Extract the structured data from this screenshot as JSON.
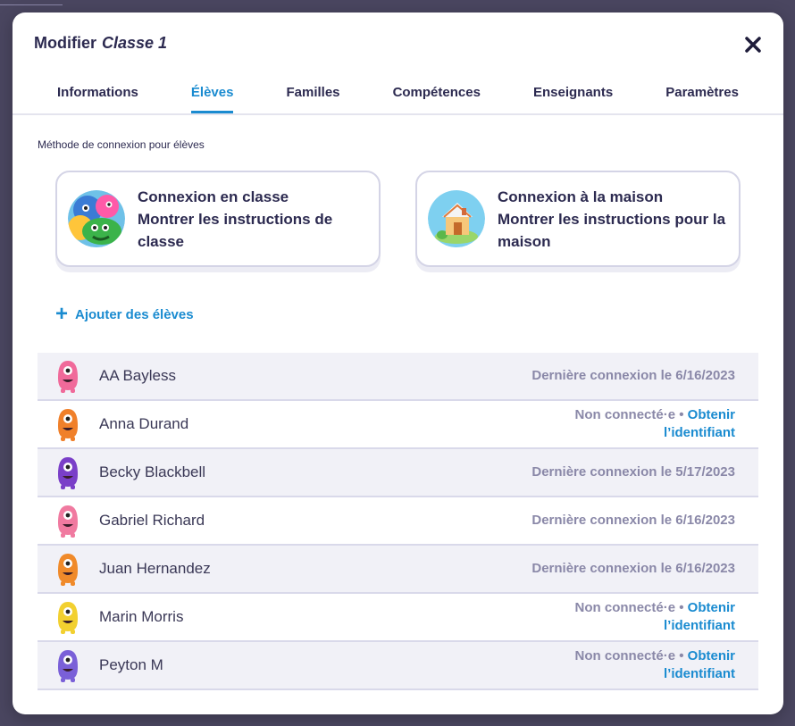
{
  "modal": {
    "title_prefix": "Modifier",
    "class_name": "Classe 1"
  },
  "tabs": [
    {
      "label": "Informations"
    },
    {
      "label": "Élèves"
    },
    {
      "label": "Familles"
    },
    {
      "label": "Compétences"
    },
    {
      "label": "Enseignants"
    },
    {
      "label": "Paramètres"
    }
  ],
  "login": {
    "section_label": "Méthode de connexion pour élèves",
    "class_card": {
      "line1": "Connexion en classe",
      "line2": "Montrer les instructions de classe"
    },
    "home_card": {
      "line1": "Connexion à la maison",
      "line2": "Montrer les instructions pour la maison"
    }
  },
  "add_students_label": "Ajouter des élèves",
  "students": [
    {
      "name": "AA Bayless",
      "status": "Dernière connexion le 6/16/2023",
      "color": "#f06a9a"
    },
    {
      "name": "Anna Durand",
      "status": "Non connecté·e",
      "link": "Obtenir l’identifiant",
      "color": "#f0802a"
    },
    {
      "name": "Becky Blackbell",
      "status": "Dernière connexion le 5/17/2023",
      "color": "#7a3fc8"
    },
    {
      "name": "Gabriel Richard",
      "status": "Dernière connexion le 6/16/2023",
      "color": "#f07aa0"
    },
    {
      "name": "Juan Hernandez",
      "status": "Dernière connexion le 6/16/2023",
      "color": "#f08a2a"
    },
    {
      "name": "Marin Morris",
      "status": "Non connecté·e",
      "link": "Obtenir l’identifiant",
      "color": "#f2d030"
    },
    {
      "name": "Peyton M",
      "status": "Non connecté·e",
      "link": "Obtenir l’identifiant",
      "color": "#7a60d8"
    }
  ]
}
